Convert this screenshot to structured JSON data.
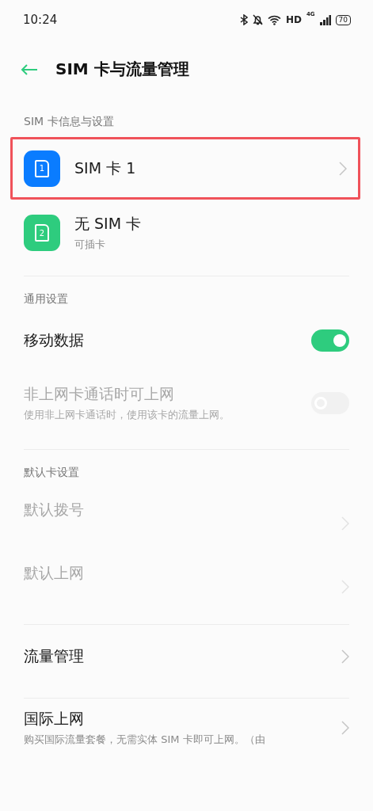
{
  "status_bar": {
    "time": "10:24",
    "hd": "HD",
    "network": "4G",
    "battery": "70"
  },
  "header": {
    "title": "SIM 卡与流量管理"
  },
  "sections": [
    {
      "label": "SIM 卡信息与设置",
      "items": [
        {
          "kind": "sim",
          "title": "SIM 卡 1",
          "slot": "1",
          "color": "#0a7cff",
          "highlighted": true,
          "chevron": true
        },
        {
          "kind": "sim",
          "title": "无 SIM 卡",
          "subtitle": "可插卡",
          "slot": "2",
          "color": "#2ecc7e",
          "highlighted": false,
          "chevron": false
        }
      ]
    },
    {
      "label": "通用设置",
      "items": [
        {
          "kind": "toggle",
          "title": "移动数据",
          "on": true,
          "disabled": false
        },
        {
          "kind": "toggle",
          "title": "非上网卡通话时可上网",
          "subtitle": "使用非上网卡通话时，使用该卡的流量上网。",
          "on": false,
          "disabled": true
        }
      ]
    },
    {
      "label": "默认卡设置",
      "items": [
        {
          "kind": "nav",
          "title": "默认拨号",
          "disabled": true
        },
        {
          "kind": "nav",
          "title": "默认上网",
          "disabled": true
        }
      ]
    },
    {
      "items": [
        {
          "kind": "nav",
          "title": "流量管理",
          "disabled": false
        }
      ]
    },
    {
      "items": [
        {
          "kind": "nav",
          "title": "国际上网",
          "subtitle": "购买国际流量套餐，无需实体 SIM 卡即可上网。（由",
          "disabled": false
        }
      ]
    }
  ]
}
